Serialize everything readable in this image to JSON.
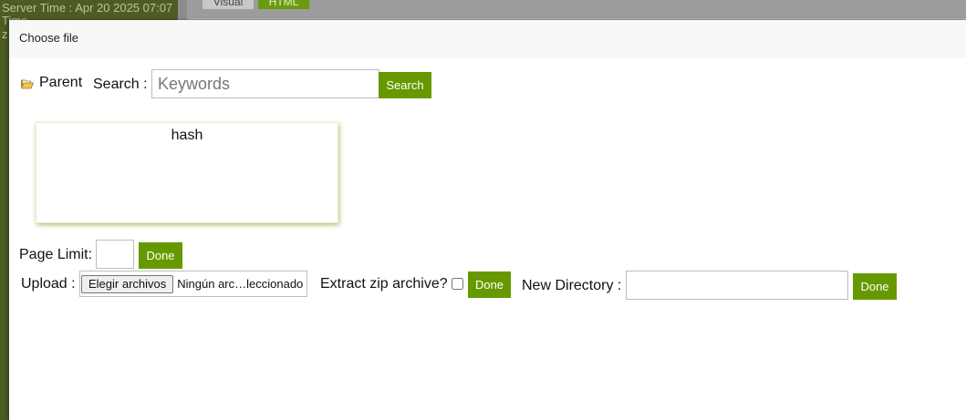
{
  "background": {
    "server_time": "Server Time : Apr 20 2025 07:07",
    "time_label": "Time",
    "z_text": "z",
    "tab_visual": "Visual",
    "tab_html": "HTML"
  },
  "modal": {
    "title": "Choose file",
    "toolbar": {
      "parent_label": "Parent",
      "search_label": "Search :",
      "search_placeholder": "Keywords",
      "search_value": "",
      "search_button": "Search"
    },
    "files": [
      {
        "name": "hash"
      }
    ],
    "page_limit": {
      "label": "Page Limit:",
      "value": "",
      "button": "Done"
    },
    "upload": {
      "label": "Upload :",
      "choose_button": "Elegir archivos",
      "status": "Ningún arc…leccionado",
      "extract_label": "Extract zip archive?",
      "extract_checked": false,
      "button": "Done"
    },
    "new_directory": {
      "label": "New Directory :",
      "value": "",
      "button": "Done"
    }
  },
  "colors": {
    "accent_green": "#669900",
    "sidebar_bg": "#4d5c23"
  }
}
